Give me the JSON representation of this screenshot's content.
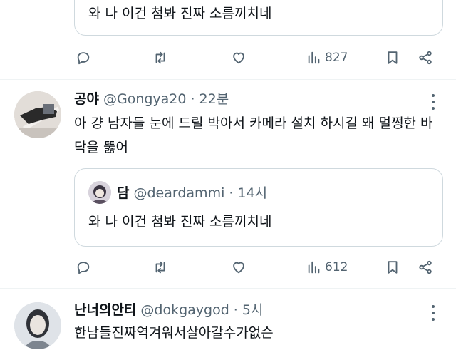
{
  "top_quote": {
    "text": "와 나 이건 첨봐 진짜 소름끼치네"
  },
  "top_actions": {
    "views": "827"
  },
  "tweet1": {
    "name": "공야",
    "handle": "@Gongya20",
    "sep": "·",
    "time": "22분",
    "text": "아 걍 남자들 눈에 드릴 박아서 카메라 설치 하시길 왜 멀쩡한 바닥을 뚫어",
    "quote": {
      "name": "담",
      "handle": "@deardammi",
      "sep": "·",
      "time": "14시",
      "text": "와 나 이건 첨봐 진짜 소름끼치네"
    },
    "views": "612"
  },
  "tweet2": {
    "name": "난너의안티",
    "handle": "@dokgaygod",
    "sep": "·",
    "time": "5시",
    "text": "한남들진짜역겨워서살아갈수가없슨"
  },
  "icons": [
    "reply-icon",
    "retweet-icon",
    "like-icon",
    "views-icon",
    "bookmark-icon",
    "share-icon",
    "more-icon"
  ]
}
